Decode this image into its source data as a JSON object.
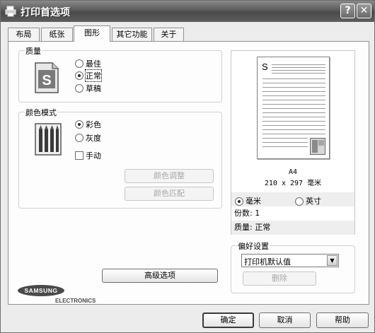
{
  "window": {
    "title": "打印首选项",
    "help_glyph": "?",
    "close_glyph": "✕"
  },
  "tabs": [
    {
      "label": "布局",
      "active": false
    },
    {
      "label": "纸张",
      "active": false
    },
    {
      "label": "图形",
      "active": true
    },
    {
      "label": "其它功能",
      "active": false
    },
    {
      "label": "关于",
      "active": false
    }
  ],
  "quality": {
    "group_label": "质量",
    "icon_letter": "S",
    "options": [
      "最佳",
      "正常",
      "草稿"
    ],
    "selected": "正常"
  },
  "color_mode": {
    "group_label": "颜色模式",
    "options": [
      "彩色",
      "灰度"
    ],
    "selected": "彩色",
    "manual_label": "手动",
    "manual_checked": false,
    "adjust_button": "颜色调整",
    "match_button": "颜色匹配"
  },
  "advanced_button": "高级选项",
  "brand": {
    "name": "SAMSUNG",
    "sub": "ELECTRONICS"
  },
  "preview": {
    "page_letter": "S",
    "paper_name": "A4",
    "paper_size": "210 x 297 毫米",
    "units": [
      "毫米",
      "英寸"
    ],
    "unit_selected": "毫米",
    "copies_label": "份数: 1",
    "quality_label": "质量: 正常"
  },
  "favorites": {
    "group_label": "偏好设置",
    "selected": "打印机默认值",
    "delete_button": "删除"
  },
  "footer": {
    "ok": "确定",
    "cancel": "取消",
    "help": "帮助"
  }
}
